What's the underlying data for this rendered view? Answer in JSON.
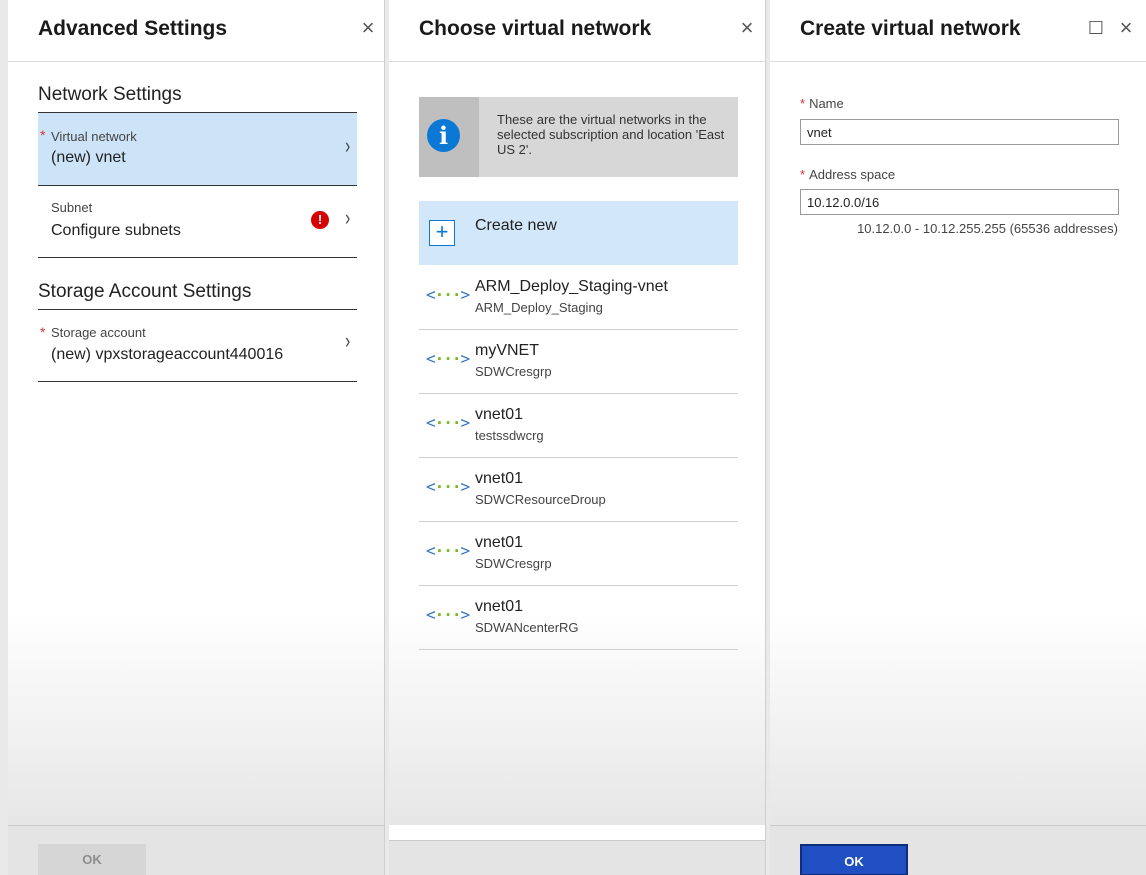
{
  "advanced_settings": {
    "title": "Advanced Settings",
    "close_symbol": "×",
    "network_section_title": "Network Settings",
    "virtual_network": {
      "label": "Virtual network",
      "value": "(new) vnet",
      "required": "*"
    },
    "subnet": {
      "label": "Subnet",
      "value": "Configure subnets",
      "error_symbol": "!"
    },
    "storage_section_title": "Storage Account Settings",
    "storage_account": {
      "label": "Storage account",
      "value": "(new) vpxstorageaccount440016",
      "required": "*"
    },
    "chevron": "›",
    "ok_label": "OK"
  },
  "choose_vnet": {
    "title": "Choose virtual network",
    "close_symbol": "×",
    "info_text": "These are the virtual networks in the selected subscription and location 'East US 2'.",
    "info_symbol": "i",
    "create_new_label": "Create new",
    "plus_symbol": "+",
    "networks": [
      {
        "name": "ARM_Deploy_Staging-vnet",
        "resource_group": "ARM_Deploy_Staging"
      },
      {
        "name": "myVNET",
        "resource_group": "SDWCresgrp"
      },
      {
        "name": "vnet01",
        "resource_group": "testssdwcrg"
      },
      {
        "name": "vnet01",
        "resource_group": "SDWCResourceDroup"
      },
      {
        "name": "vnet01",
        "resource_group": "SDWCresgrp"
      },
      {
        "name": "vnet01",
        "resource_group": "SDWANcenterRG"
      }
    ]
  },
  "create_vnet": {
    "title": "Create virtual network",
    "maximize_symbol": "☐",
    "close_symbol": "×",
    "name_label": "Name",
    "name_value": "vnet",
    "address_label": "Address space",
    "address_value": "10.12.0.0/16",
    "address_hint": "10.12.0.0 - 10.12.255.255 (65536 addresses)",
    "required": "*",
    "ok_label": "OK"
  },
  "colors": {
    "selected_bg": "#cde3f7",
    "accent_blue": "#0a78d4",
    "ok_blue": "#1f4fc2",
    "required_red": "#d13438",
    "vnet_dots_green": "#7bb52a"
  }
}
